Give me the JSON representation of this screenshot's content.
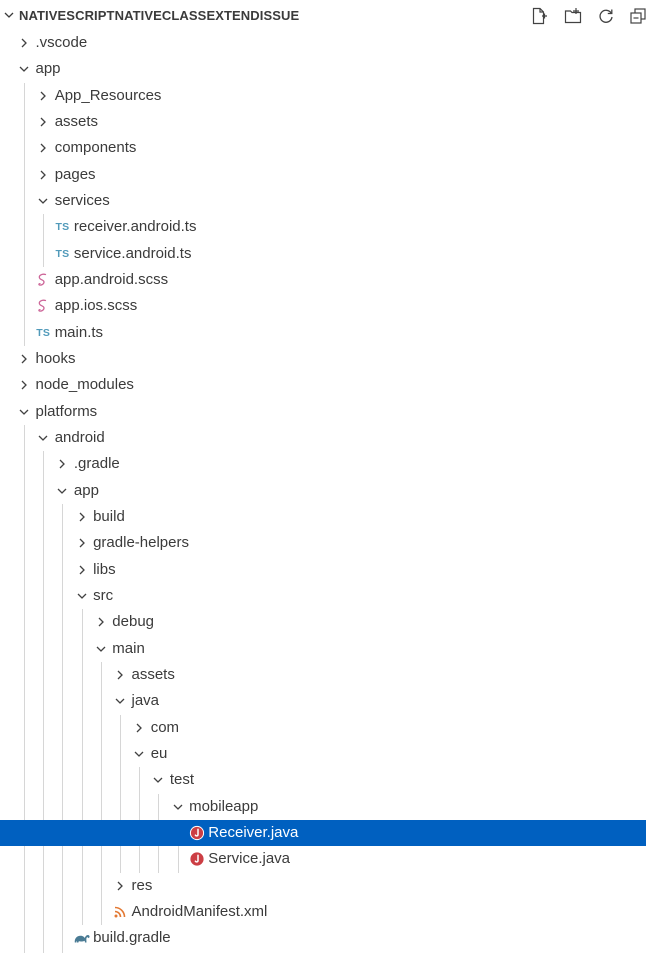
{
  "explorer": {
    "title": "NATIVESCRIPTNATIVECLASSEXTENDISSUE",
    "actions": [
      "new-file-icon",
      "new-folder-icon",
      "refresh-icon",
      "collapse-all-icon"
    ],
    "colors": {
      "selection_bg": "#0060c0",
      "ts_icon": "#519aba",
      "scss_icon": "#cd6799",
      "java_icon": "#cc3e44",
      "xml_icon": "#e37933",
      "gradle_icon": "#4a7b94",
      "guide": "#d6d6d6"
    },
    "tree": [
      {
        "label": ".vscode",
        "depth": 0,
        "type": "folder",
        "expanded": false
      },
      {
        "label": "app",
        "depth": 0,
        "type": "folder",
        "expanded": true
      },
      {
        "label": "App_Resources",
        "depth": 1,
        "type": "folder",
        "expanded": false
      },
      {
        "label": "assets",
        "depth": 1,
        "type": "folder",
        "expanded": false
      },
      {
        "label": "components",
        "depth": 1,
        "type": "folder",
        "expanded": false
      },
      {
        "label": "pages",
        "depth": 1,
        "type": "folder",
        "expanded": false
      },
      {
        "label": "services",
        "depth": 1,
        "type": "folder",
        "expanded": true
      },
      {
        "label": "receiver.android.ts",
        "depth": 2,
        "type": "file",
        "icon": "ts"
      },
      {
        "label": "service.android.ts",
        "depth": 2,
        "type": "file",
        "icon": "ts"
      },
      {
        "label": "app.android.scss",
        "depth": 1,
        "type": "file",
        "icon": "scss"
      },
      {
        "label": "app.ios.scss",
        "depth": 1,
        "type": "file",
        "icon": "scss"
      },
      {
        "label": "main.ts",
        "depth": 1,
        "type": "file",
        "icon": "ts"
      },
      {
        "label": "hooks",
        "depth": 0,
        "type": "folder",
        "expanded": false
      },
      {
        "label": "node_modules",
        "depth": 0,
        "type": "folder",
        "expanded": false
      },
      {
        "label": "platforms",
        "depth": 0,
        "type": "folder",
        "expanded": true
      },
      {
        "label": "android",
        "depth": 1,
        "type": "folder",
        "expanded": true
      },
      {
        "label": ".gradle",
        "depth": 2,
        "type": "folder",
        "expanded": false
      },
      {
        "label": "app",
        "depth": 2,
        "type": "folder",
        "expanded": true
      },
      {
        "label": "build",
        "depth": 3,
        "type": "folder",
        "expanded": false
      },
      {
        "label": "gradle-helpers",
        "depth": 3,
        "type": "folder",
        "expanded": false
      },
      {
        "label": "libs",
        "depth": 3,
        "type": "folder",
        "expanded": false
      },
      {
        "label": "src",
        "depth": 3,
        "type": "folder",
        "expanded": true
      },
      {
        "label": "debug",
        "depth": 4,
        "type": "folder",
        "expanded": false
      },
      {
        "label": "main",
        "depth": 4,
        "type": "folder",
        "expanded": true
      },
      {
        "label": "assets",
        "depth": 5,
        "type": "folder",
        "expanded": false
      },
      {
        "label": "java",
        "depth": 5,
        "type": "folder",
        "expanded": true
      },
      {
        "label": "com",
        "depth": 6,
        "type": "folder",
        "expanded": false
      },
      {
        "label": "eu",
        "depth": 6,
        "type": "folder",
        "expanded": true
      },
      {
        "label": "test",
        "depth": 7,
        "type": "folder",
        "expanded": true
      },
      {
        "label": "mobileapp",
        "depth": 8,
        "type": "folder",
        "expanded": true
      },
      {
        "label": "Receiver.java",
        "depth": 9,
        "type": "file",
        "icon": "java",
        "selected": true
      },
      {
        "label": "Service.java",
        "depth": 9,
        "type": "file",
        "icon": "java"
      },
      {
        "label": "res",
        "depth": 5,
        "type": "folder",
        "expanded": false
      },
      {
        "label": "AndroidManifest.xml",
        "depth": 5,
        "type": "file",
        "icon": "xml"
      },
      {
        "label": "build.gradle",
        "depth": 3,
        "type": "file",
        "icon": "gradle"
      }
    ]
  }
}
